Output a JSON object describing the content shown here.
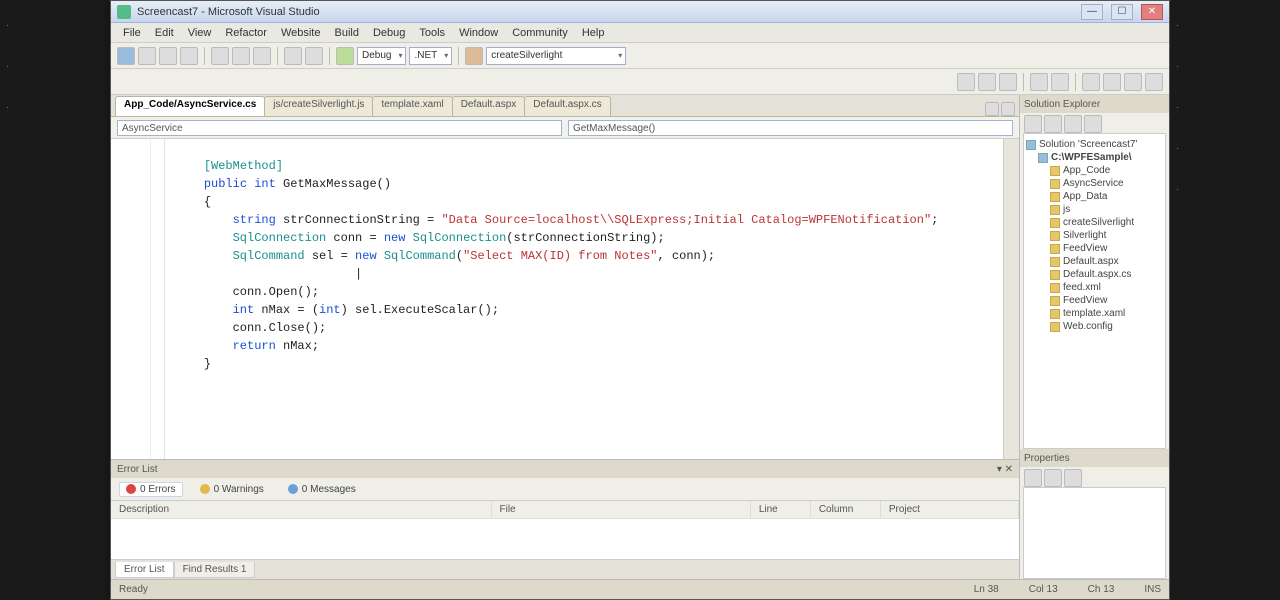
{
  "window": {
    "title": "Screencast7 - Microsoft Visual Studio"
  },
  "menu": [
    "File",
    "Edit",
    "View",
    "Refactor",
    "Website",
    "Build",
    "Debug",
    "Tools",
    "Window",
    "Community",
    "Help"
  ],
  "toolbar": {
    "config": "Debug",
    "platform": ".NET",
    "find": "createSilverlight"
  },
  "tabs": [
    {
      "label": "App_Code/AsyncService.cs",
      "active": true
    },
    {
      "label": "js/createSilverlight.js",
      "active": false
    },
    {
      "label": "template.xaml",
      "active": false
    },
    {
      "label": "Default.aspx",
      "active": false
    },
    {
      "label": "Default.aspx.cs",
      "active": false
    }
  ],
  "nav": {
    "left": "AsyncService",
    "right": "GetMaxMessage()"
  },
  "code": {
    "attr": "[WebMethod]",
    "sig_kw1": "public",
    "sig_kw2": "int",
    "sig_name": " GetMaxMessage()",
    "brace_o": "{",
    "l1_kw": "string",
    "l1_var": " strConnectionString = ",
    "l1_str": "\"Data Source=localhost\\\\SQLExpress;Initial Catalog=WPFENotification\"",
    "l2_type": "SqlConnection",
    "l2_mid": " conn = ",
    "l2_kw": "new ",
    "l2_type2": "SqlConnection",
    "l2_rest": "(strConnectionString);",
    "l3_type": "SqlCommand",
    "l3_mid": " sel = ",
    "l3_kw": "new ",
    "l3_type2": "SqlCommand",
    "l3_p": "(",
    "l3_str": "\"Select MAX(ID) from Notes\"",
    "l3_rest": ", conn);",
    "l5": "conn.Open();",
    "l6_kw": "int",
    "l6_rest": " nMax = (",
    "l6_kw2": "int",
    "l6_rest2": ") sel.ExecuteScalar();",
    "l7": "conn.Close();",
    "l8_kw": "return",
    "l8_rest": " nMax;",
    "brace_c": "}"
  },
  "errorlist": {
    "title": "Error List",
    "errors": "0 Errors",
    "warnings": "0 Warnings",
    "messages": "0 Messages",
    "cols": {
      "c1": "Description",
      "c2": "File",
      "c3": "Line",
      "c4": "Column",
      "c5": "Project"
    },
    "bottomtabs": [
      "Error List",
      "Find Results 1"
    ]
  },
  "solution": {
    "title": "Solution Explorer",
    "root": "Solution 'Screencast7'",
    "project": "C:\\WPFESample\\",
    "items": [
      "App_Code",
      "AsyncService",
      "App_Data",
      "js",
      "createSilverlight",
      "Silverlight",
      "FeedView",
      "Default.aspx",
      "Default.aspx.cs",
      "feed.xml",
      "FeedView",
      "template.xaml",
      "Web.config"
    ]
  },
  "properties": {
    "title": "Properties"
  },
  "status": {
    "ready": "Ready",
    "ln": "Ln 38",
    "col": "Col 13",
    "ch": "Ch 13",
    "ins": "INS"
  }
}
